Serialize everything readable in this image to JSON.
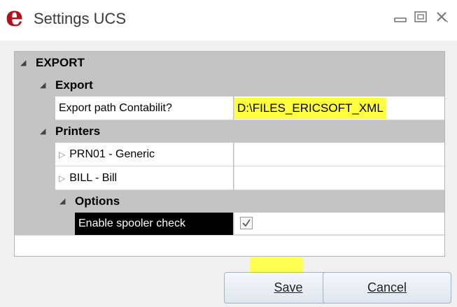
{
  "window": {
    "logo_letter": "e",
    "title": "Settings UCS",
    "icons": [
      "minimize-icon",
      "maximize-icon",
      "close-icon"
    ]
  },
  "grid": {
    "export_category": "EXPORT",
    "export_subcategory": "Export",
    "export_path_label": "Export path Contabilit?",
    "export_path_value": "D:\\FILES_ERICSOFT_XML",
    "printers_category": "Printers",
    "printers": [
      {
        "label": "PRN01 - Generic",
        "value": ""
      },
      {
        "label": "BILL - Bill",
        "value": ""
      }
    ],
    "options_category": "Options",
    "spooler_label": "Enable spooler check",
    "spooler_checked": true
  },
  "buttons": {
    "save": "Save",
    "cancel": "Cancel"
  },
  "colors": {
    "highlight": "#ffff40",
    "logo": "#b0131d",
    "category_bg": "#c4c4c4",
    "selected_bg": "#000000"
  }
}
